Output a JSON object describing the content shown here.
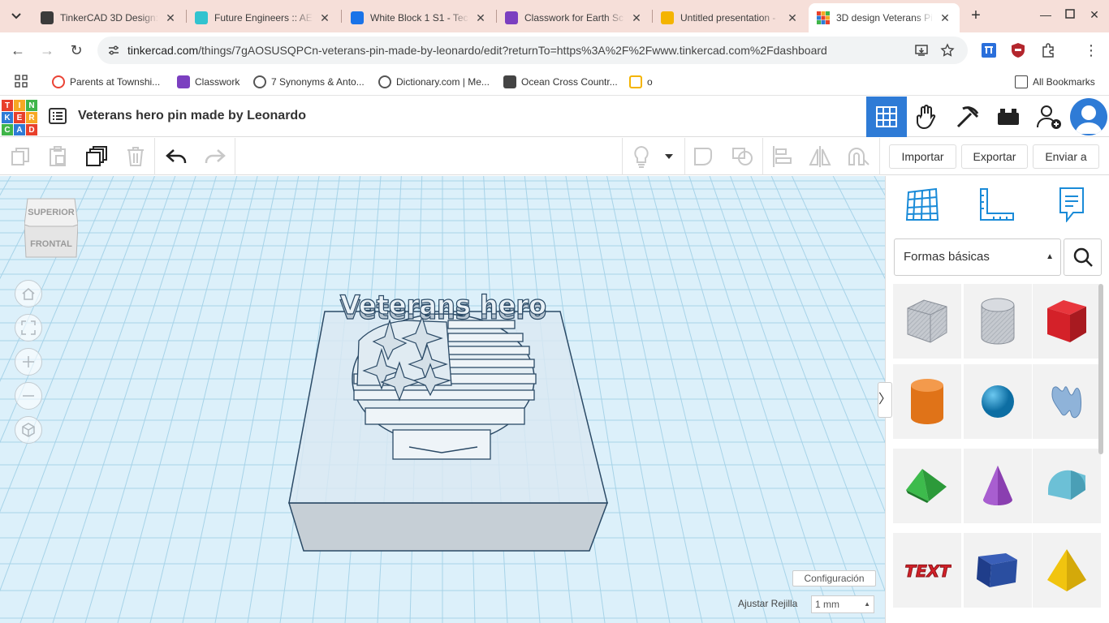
{
  "browser": {
    "tabs": [
      {
        "title": "TinkerCAD 3D Design:",
        "favicon": "classroom-icon",
        "color": "#3b3b3b"
      },
      {
        "title": "Future Engineers :: AE",
        "favicon": "future-engineers-icon",
        "color": "#31c3cf"
      },
      {
        "title": "White Block 1 S1 - Tec",
        "favicon": "classroom-icon",
        "color": "#1a73e8"
      },
      {
        "title": "Classwork for Earth Sc",
        "favicon": "classroom-icon",
        "color": "#7b3fc0"
      },
      {
        "title": "Untitled presentation -",
        "favicon": "slides-icon",
        "color": "#f4b400"
      },
      {
        "title": "3D design Veterans Pi",
        "favicon": "tinkercad-icon",
        "color": "#2e7bd6"
      }
    ],
    "url_host": "tinkercad.com",
    "url_path": "/things/7gAOSUSQPCn-veterans-pin-made-by-leonardo/edit?returnTo=https%3A%2F%2Fwww.tinkercad.com%2Fdashboard",
    "bookmarks": [
      {
        "label": "Parents at Townshi...",
        "icon": "google-icon",
        "color": "#ea4335"
      },
      {
        "label": "Classwork",
        "icon": "classroom-icon",
        "color": "#7b3fc0"
      },
      {
        "label": "7 Synonyms & Anto...",
        "icon": "globe-icon",
        "color": "#555555"
      },
      {
        "label": "Dictionary.com | Me...",
        "icon": "globe-icon",
        "color": "#555555"
      },
      {
        "label": "Ocean Cross Countr...",
        "icon": "classroom-icon",
        "color": "#444444"
      },
      {
        "label": "o",
        "icon": "slides-icon",
        "color": "#f4b400"
      }
    ],
    "all_bookmarks": "All Bookmarks"
  },
  "tinkercad": {
    "design_title": "Veterans hero pin made by Leonardo",
    "actions": {
      "import": "Importar",
      "export": "Exportar",
      "send_to": "Enviar a"
    },
    "viewcube": {
      "top": "SUPERIOR",
      "front": "FRONTAL"
    },
    "settings": "Configuración",
    "snap_label": "Ajustar Rejilla",
    "snap_value": "1 mm",
    "shape_category": "Formas básicas",
    "model_text": "Veterans hero",
    "shapes": [
      {
        "name": "box-hole",
        "color": "#b8bcc4"
      },
      {
        "name": "cylinder-hole",
        "color": "#c4c7cc"
      },
      {
        "name": "box",
        "color": "#d42129"
      },
      {
        "name": "cylinder",
        "color": "#e07318"
      },
      {
        "name": "sphere",
        "color": "#1a90c8"
      },
      {
        "name": "scribble",
        "color": "#8fb3d9"
      },
      {
        "name": "roof",
        "color": "#2c9a3a"
      },
      {
        "name": "cone",
        "color": "#8a3fb0"
      },
      {
        "name": "round-roof",
        "color": "#6cc0d6"
      },
      {
        "name": "text",
        "color": "#d42129",
        "label": "TEXT"
      },
      {
        "name": "half-box",
        "color": "#1f3d8a"
      },
      {
        "name": "pyramid",
        "color": "#f1c40f"
      }
    ],
    "accent": "#2e7bd6"
  }
}
